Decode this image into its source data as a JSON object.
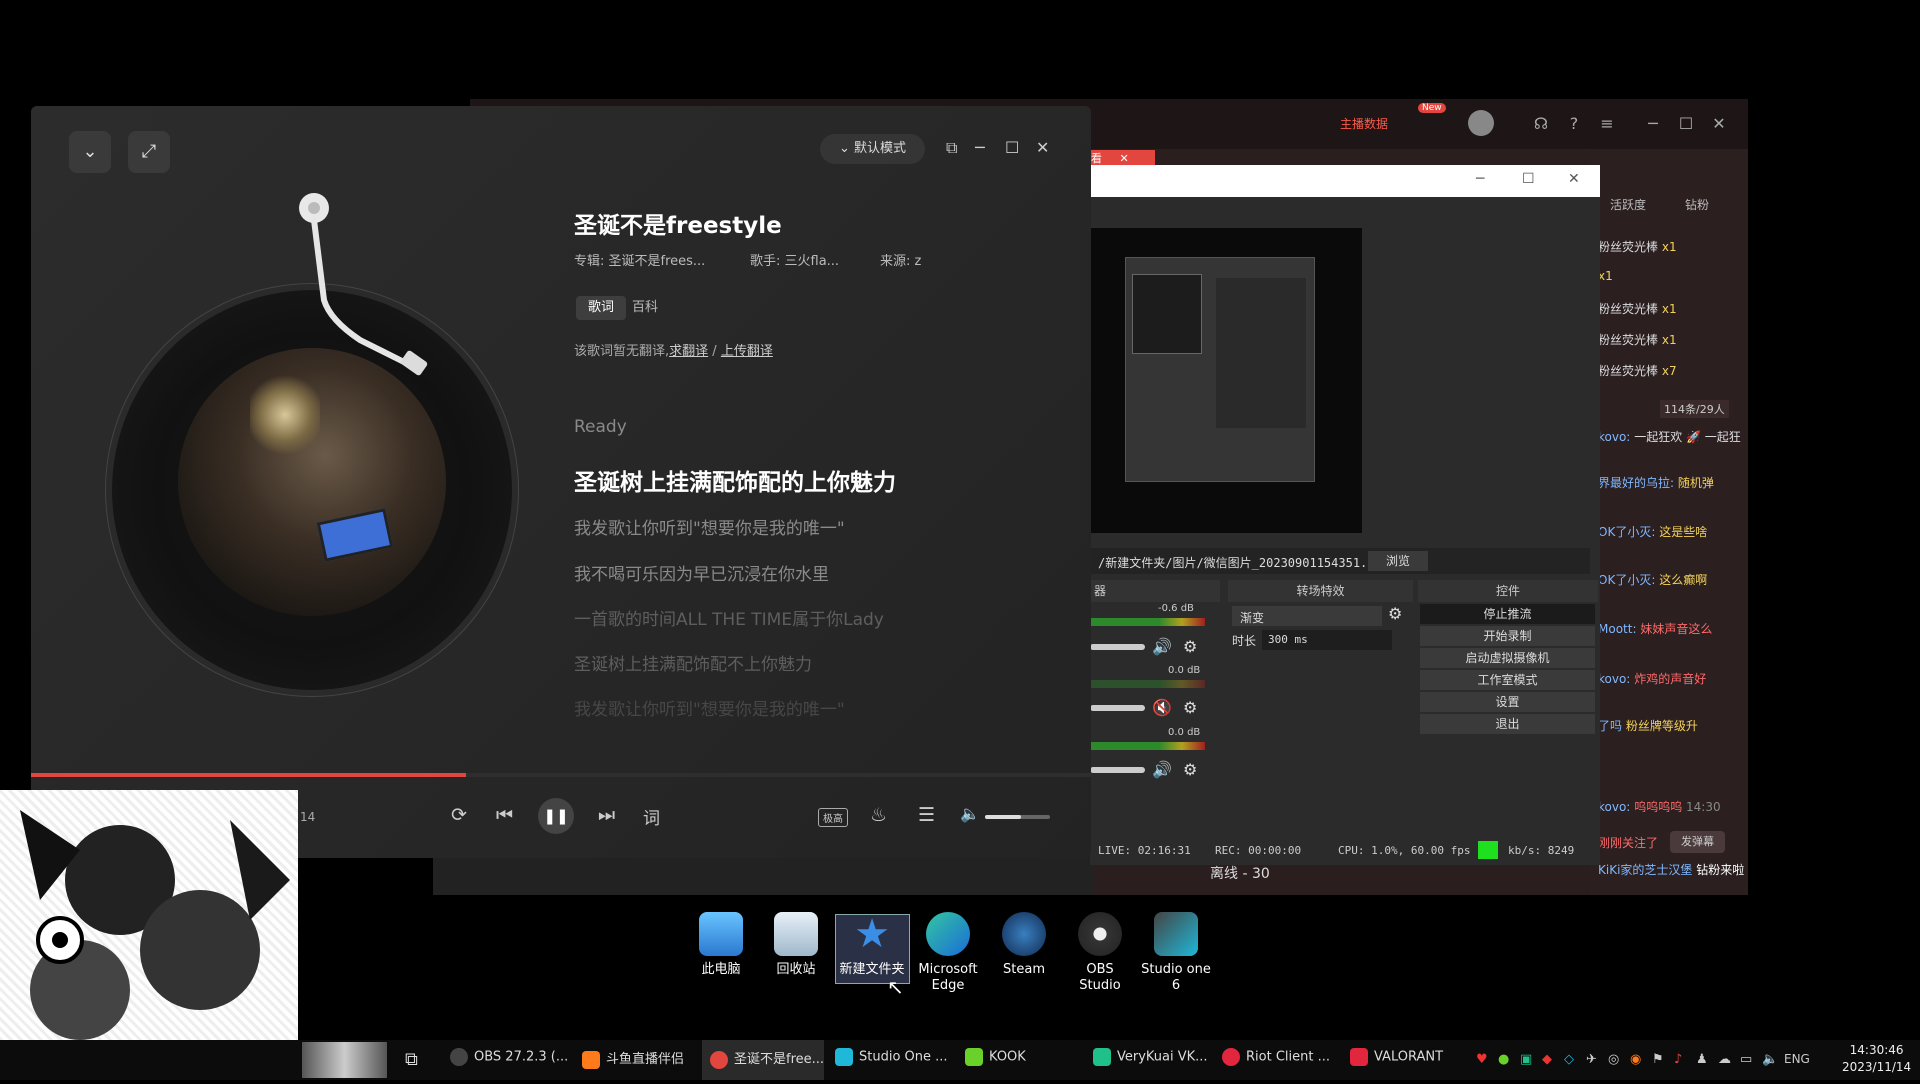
{
  "stream_app": {
    "top_badge": "主播数据",
    "new_tag": "New",
    "live_tab": "看",
    "tabs": [
      "活跃度",
      "钻粉"
    ],
    "viewers": "114条/29人",
    "line_info": "离线 - 30",
    "chat": [
      {
        "name": "",
        "text": "粉丝荧光棒",
        "count": "x1"
      },
      {
        "name": "",
        "text": "",
        "count": "x1"
      },
      {
        "name": "",
        "text": "粉丝荧光棒",
        "count": "x1"
      },
      {
        "name": "",
        "text": "粉丝荧光棒",
        "count": "x1"
      },
      {
        "name": "",
        "text": "粉丝荧光棒",
        "count": "x7"
      },
      {
        "name": "kovo:",
        "text": "一起狂欢 🚀 一起狂",
        "count": ""
      },
      {
        "name": "界最好的乌拉:",
        "text": "随机弹",
        "count": ""
      },
      {
        "name": "OK了小灭:",
        "text": "这是些啥",
        "count": ""
      },
      {
        "name": "OK了小灭:",
        "text": "这么癫啊",
        "count": ""
      },
      {
        "name": "Moott:",
        "text": "妹妹声音这么",
        "count": ""
      },
      {
        "name": "kovo:",
        "text": "炸鸡的声音好",
        "count": ""
      },
      {
        "name": "了吗",
        "text": "粉丝牌等级升",
        "count": ""
      },
      {
        "name": "kovo:",
        "text": "呜呜呜呜",
        "count": "14:30"
      },
      {
        "name": "",
        "text": "刚刚关注了",
        "count": "发弹幕"
      },
      {
        "name": "KiKi家的芝士汉堡",
        "text": "钻粉来啦",
        "count": ""
      }
    ]
  },
  "obs": {
    "path": "/新建文件夹/图片/微信图片_20230901154351.jpg",
    "browse": "浏览",
    "panel_audio": "器",
    "panel_transitions": "转场特效",
    "panel_controls": "控件",
    "transition": "渐变",
    "duration_label": "时长",
    "duration_value": "300 ms",
    "db": [
      "-0.6 dB",
      "0.0 dB",
      "0.0 dB"
    ],
    "buttons": [
      "停止推流",
      "开始录制",
      "启动虚拟摄像机",
      "工作室模式",
      "设置",
      "退出"
    ],
    "status": {
      "live": "LIVE: 02:16:31",
      "rec": "REC: 00:00:00",
      "cpu": "CPU: 1.0%, 60.00 fps",
      "kbs": "kb/s: 8249"
    }
  },
  "player": {
    "mode": "默认模式",
    "title": "圣诞不是freestyle",
    "album": "专辑: 圣诞不是frees...",
    "artist": "歌手: 三火fla...",
    "source": "来源: z",
    "tab_lyrics": "歌词",
    "tab_wiki": "百科",
    "notice_prefix": "该歌词暂无翻译,",
    "notice_link1": "求翻译",
    "notice_sep": "/",
    "notice_link2": "上传翻译",
    "lyrics": [
      "Ready",
      "圣诞树上挂满配饰配的上你魅力",
      "我发歌让你听到\"想要你是我的唯一\"",
      "我不喝可乐因为早已沉浸在你水里",
      "一首歌的时间ALL THE TIME属于你Lady",
      "圣诞树上挂满配饰配不上你魅力",
      "我发歌让你听到\"想要你是我的唯一\""
    ],
    "time": "14",
    "progress": 0.41,
    "volume": 0.55,
    "lyric_btn": "词",
    "quality_btn": "极高"
  },
  "desktop_icons": [
    "此电脑",
    "回收站",
    "新建文件夹",
    "Microsoft Edge",
    "Steam",
    "OBS Studio",
    "Studio one 6"
  ],
  "taskbar": {
    "items": [
      "OBS 27.2.3 (...",
      "斗鱼直播伴侣",
      "圣诞不是free...",
      "Studio One ...",
      "KOOK",
      "VeryKuai VK...",
      "Riot Client ...",
      "VALORANT"
    ],
    "lang": "ENG",
    "time": "14:30:46",
    "date": "2023/11/14"
  },
  "colors": {
    "accent": "#e2463e",
    "obs_green": "#1fe01f"
  }
}
